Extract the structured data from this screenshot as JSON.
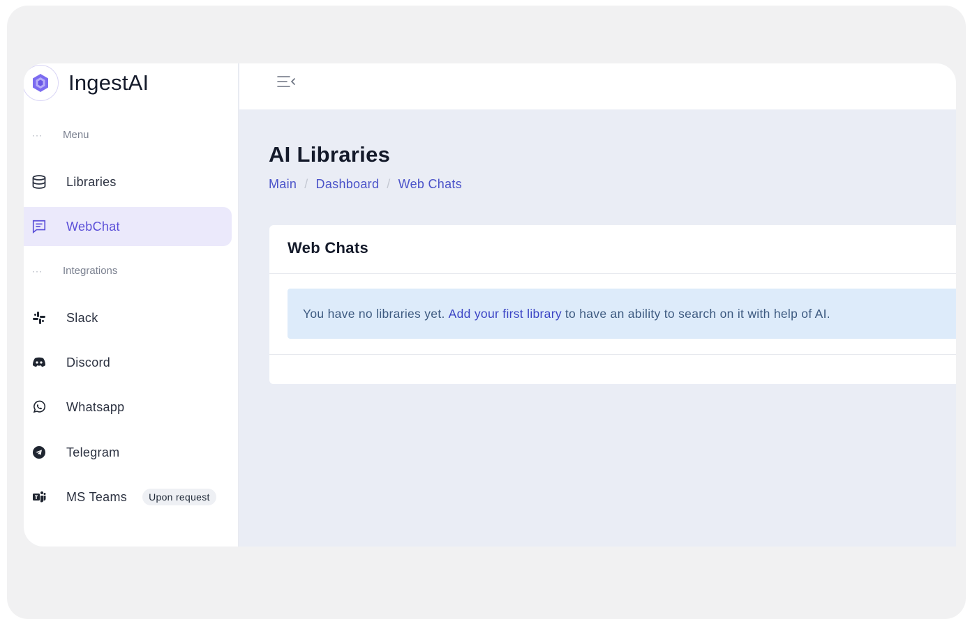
{
  "brand": {
    "name": "IngestAI",
    "accent": "#6c5ce7"
  },
  "sidebar": {
    "sections": [
      {
        "label": "Menu",
        "dots": "···"
      },
      {
        "label": "Integrations",
        "dots": "···"
      }
    ],
    "items": [
      {
        "label": "Libraries",
        "icon": "database-icon"
      },
      {
        "label": "WebChat",
        "icon": "chat-icon",
        "active": true
      },
      {
        "label": "Slack",
        "icon": "slack-icon"
      },
      {
        "label": "Discord",
        "icon": "discord-icon"
      },
      {
        "label": "Whatsapp",
        "icon": "whatsapp-icon"
      },
      {
        "label": "Telegram",
        "icon": "telegram-icon"
      },
      {
        "label": "MS Teams",
        "icon": "ms-teams-icon",
        "badge": "Upon request"
      }
    ]
  },
  "topbar": {
    "toggle_icon": "menu-collapse-icon"
  },
  "page": {
    "title": "AI Libraries",
    "breadcrumb": [
      "Main",
      "Dashboard",
      "Web Chats"
    ],
    "breadcrumb_sep": "/"
  },
  "card": {
    "title": "Web Chats",
    "alert": {
      "text_before": "You have no libraries yet.",
      "link": "Add your first library",
      "text_after": "to have an ability to search on it with help of AI."
    }
  }
}
